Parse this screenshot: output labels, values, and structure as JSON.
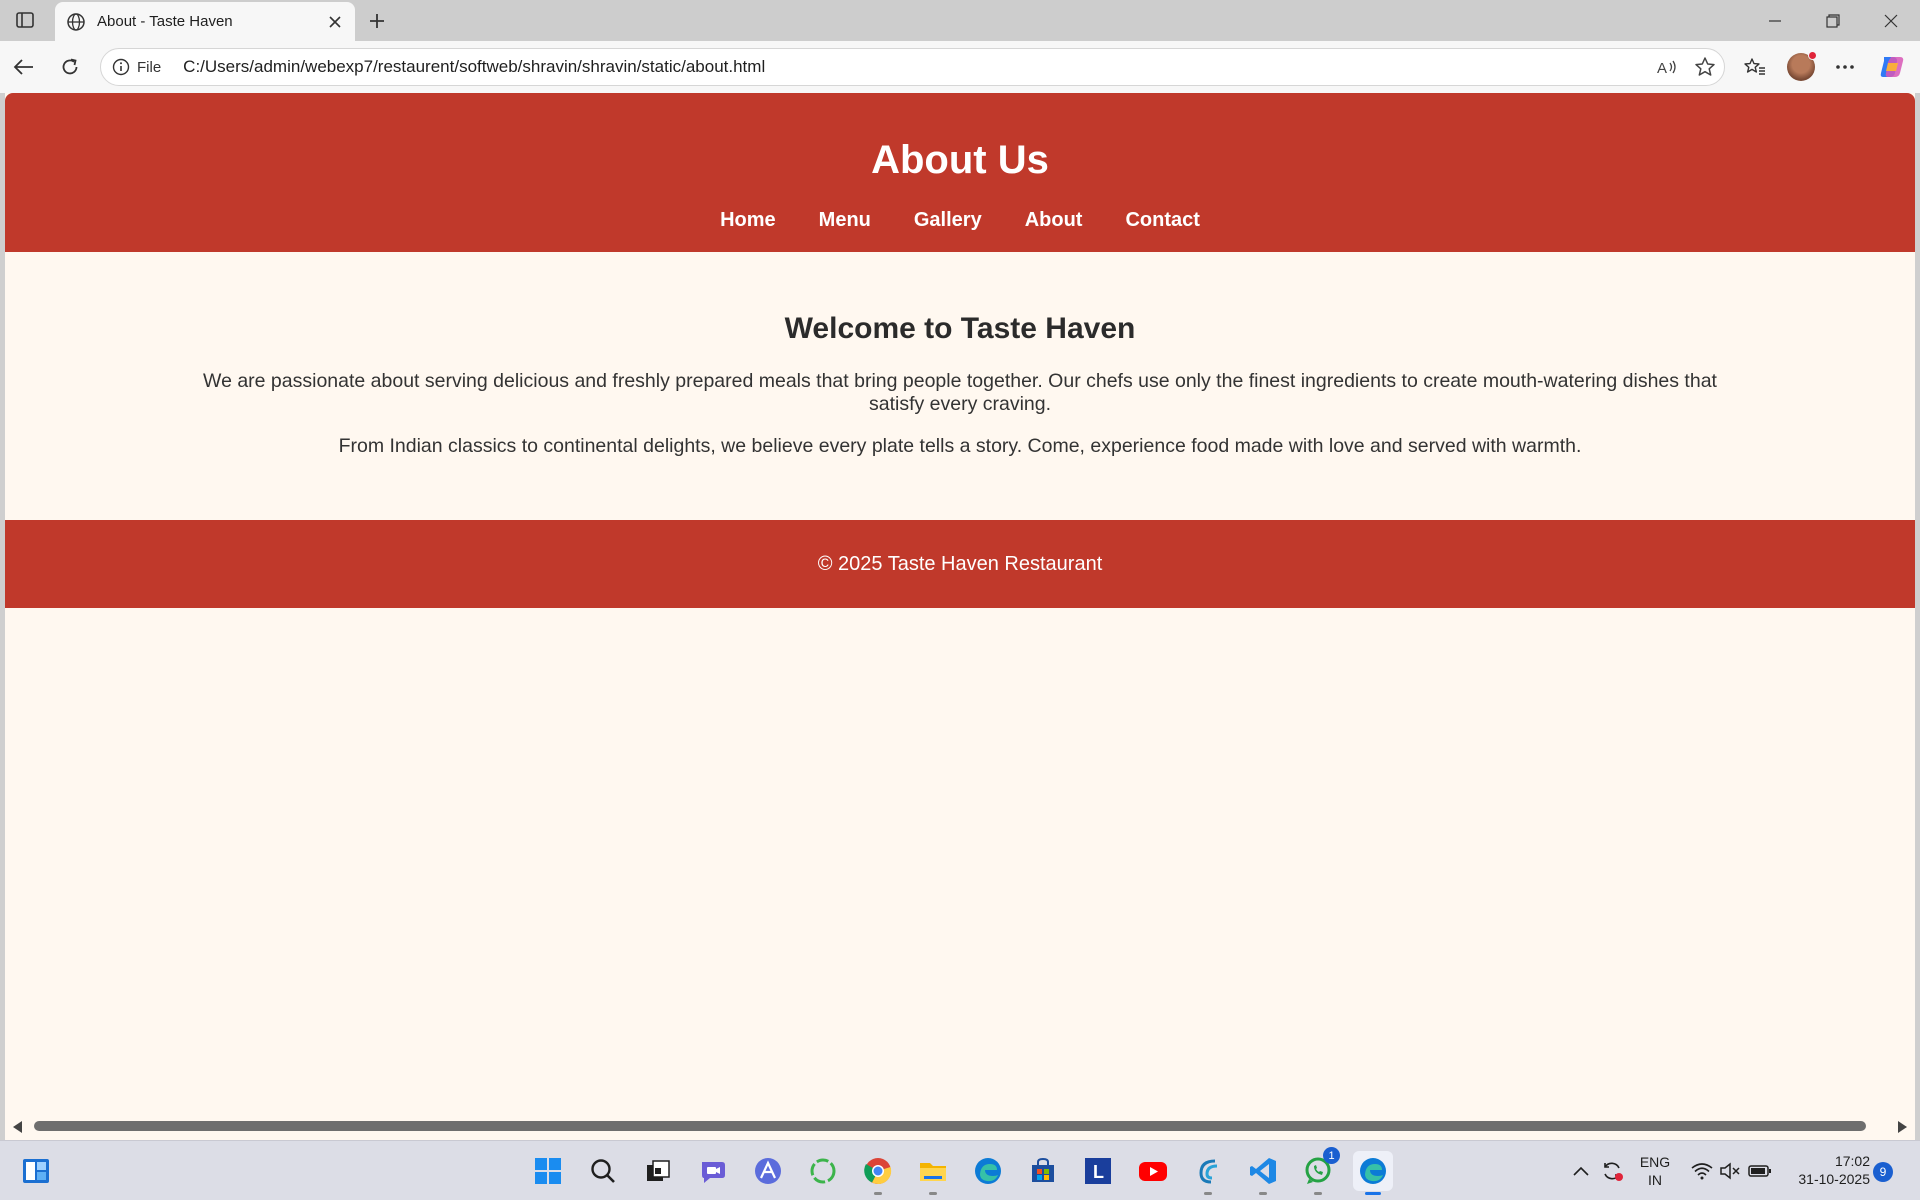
{
  "browser": {
    "tab_title": "About - Taste Haven",
    "url_scheme": "File",
    "url": "C:/Users/admin/webexp7/restaurent/softweb/shravin/shravin/static/about.html"
  },
  "site": {
    "header_title": "About Us",
    "nav": [
      {
        "label": "Home"
      },
      {
        "label": "Menu"
      },
      {
        "label": "Gallery"
      },
      {
        "label": "About"
      },
      {
        "label": "Contact"
      }
    ],
    "heading": "Welcome to Taste Haven",
    "paragraph1": "We are passionate about serving delicious and freshly prepared meals that bring people together. Our chefs use only the finest ingredients to create mouth-watering dishes that satisfy every craving.",
    "paragraph2": "From Indian classics to continental delights, we believe every plate tells a story. Come, experience food made with love and served with warmth.",
    "footer": "© 2025 Taste Haven Restaurant"
  },
  "colors": {
    "brand_red": "#c0392b",
    "page_bg": "#fff8f0"
  },
  "taskbar": {
    "apps": [
      "start",
      "search",
      "task-view",
      "meet",
      "app-proton",
      "app-refresh",
      "chrome",
      "file-explorer",
      "edge",
      "store",
      "app-l",
      "youtube",
      "app-wave",
      "vscode",
      "whatsapp",
      "edge-active"
    ],
    "whatsapp_badge": "1",
    "app_l_label": "L",
    "lang_line1": "ENG",
    "lang_line2": "IN",
    "time": "17:02",
    "date": "31-10-2025",
    "notification_count": "9"
  }
}
